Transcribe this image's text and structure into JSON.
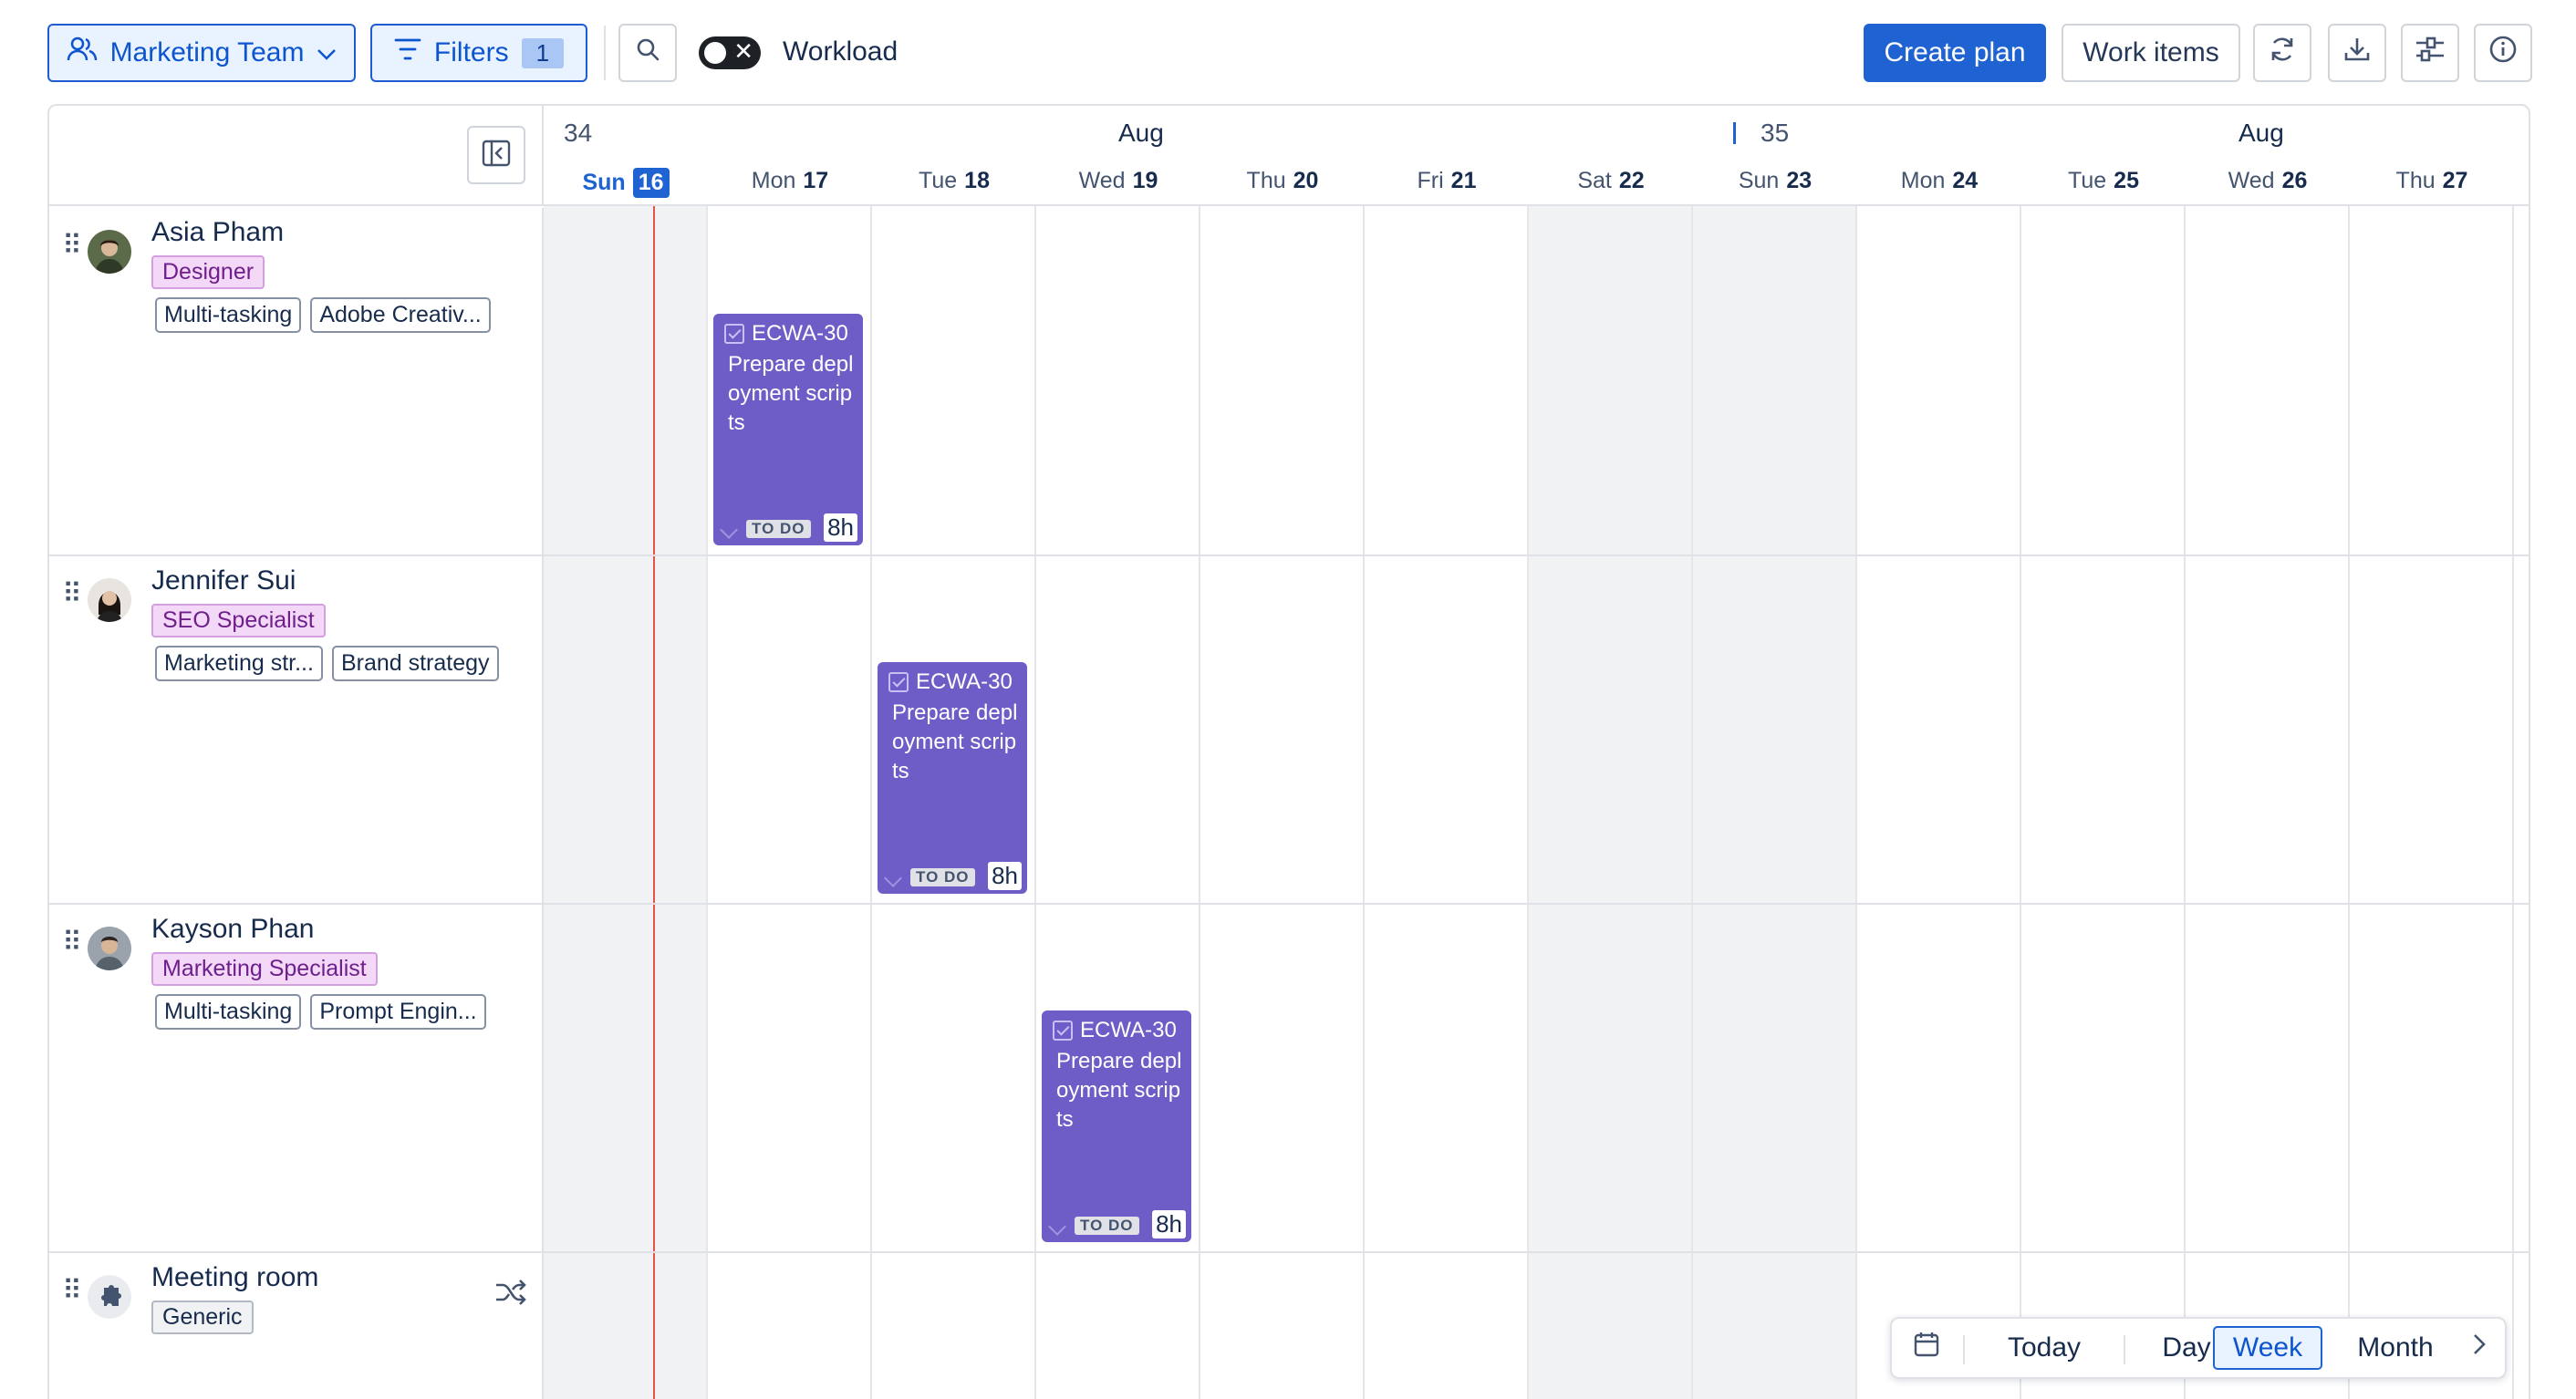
{
  "toolbar": {
    "team_label": "Marketing Team",
    "filters_label": "Filters",
    "filters_count": "1",
    "workload_label": "Workload",
    "create_plan_label": "Create plan",
    "work_items_label": "Work items"
  },
  "timeline": {
    "weeks": [
      {
        "number": "34",
        "month": "Aug"
      },
      {
        "number": "35",
        "month": "Aug"
      }
    ],
    "days": [
      {
        "day": "Sun",
        "date": "16",
        "today": true,
        "weekend": true
      },
      {
        "day": "Mon",
        "date": "17",
        "weekend": false
      },
      {
        "day": "Tue",
        "date": "18",
        "weekend": false
      },
      {
        "day": "Wed",
        "date": "19",
        "weekend": false
      },
      {
        "day": "Thu",
        "date": "20",
        "weekend": false
      },
      {
        "day": "Fri",
        "date": "21",
        "weekend": false
      },
      {
        "day": "Sat",
        "date": "22",
        "weekend": true
      },
      {
        "day": "Sun",
        "date": "23",
        "weekend": true
      },
      {
        "day": "Mon",
        "date": "24",
        "weekend": false
      },
      {
        "day": "Tue",
        "date": "25",
        "weekend": false
      },
      {
        "day": "Wed",
        "date": "26",
        "weekend": false
      },
      {
        "day": "Thu",
        "date": "27",
        "weekend": false
      }
    ]
  },
  "resources": [
    {
      "name": "Asia Pham",
      "role": "Designer",
      "skills": [
        "Multi-tasking",
        "Adobe Creativ..."
      ]
    },
    {
      "name": "Jennifer Sui",
      "role": "SEO Specialist",
      "skills": [
        "Marketing str...",
        "Brand strategy"
      ]
    },
    {
      "name": "Kayson Phan",
      "role": "Marketing Specialist",
      "skills": [
        "Multi-tasking",
        "Prompt Engin..."
      ]
    },
    {
      "name": "Meeting room",
      "role": "Generic",
      "skills": []
    }
  ],
  "tasks": [
    {
      "key": "ECWA-30",
      "title": "Prepare deployment scripts",
      "status": "TO DO",
      "hours": "8h",
      "assignee": "Asia Pham",
      "day": "Mon 17"
    },
    {
      "key": "ECWA-30",
      "title": "Prepare deployment scripts",
      "status": "TO DO",
      "hours": "8h",
      "assignee": "Jennifer Sui",
      "day": "Tue 18"
    },
    {
      "key": "ECWA-30",
      "title": "Prepare deployment scripts",
      "status": "TO DO",
      "hours": "8h",
      "assignee": "Kayson Phan",
      "day": "Wed 19"
    }
  ],
  "view_switch": {
    "today": "Today",
    "day": "Day",
    "week": "Week",
    "month": "Month",
    "active": "Week"
  },
  "colors": {
    "primary": "#1f63d2",
    "task": "#6e5dc6",
    "role_badge_bg": "#f3d8f7",
    "weekend_bg": "#f1f2f4",
    "today_line": "#e5534b"
  }
}
